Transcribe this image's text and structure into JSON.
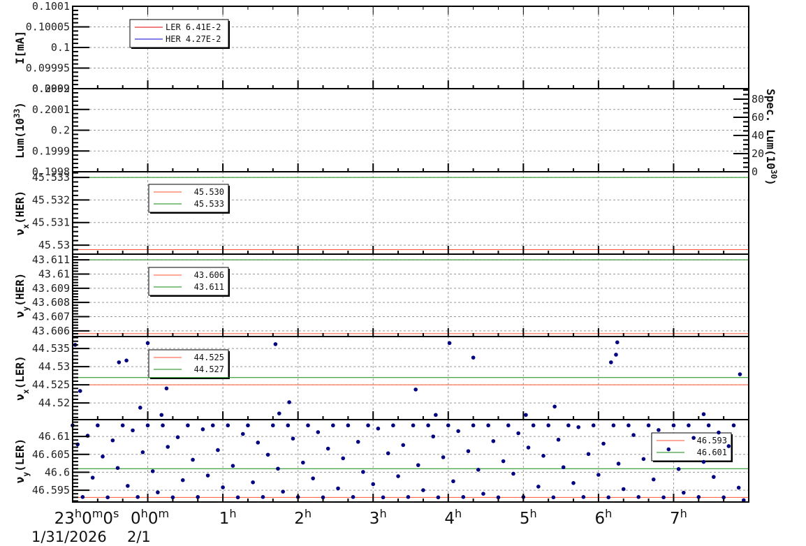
{
  "chart_data": {
    "type": "scatter",
    "x_axis": {
      "xlim": [
        "23:00",
        "08:00"
      ],
      "ticks": [
        {
          "at": "23:00",
          "parts": [
            {
              "t": "23"
            },
            {
              "t": "h",
              "sup": true
            },
            {
              "t": "0"
            },
            {
              "t": "m",
              "sup": true
            },
            {
              "t": "0"
            },
            {
              "t": "s",
              "sup": true
            }
          ]
        },
        {
          "at": "00:00",
          "parts": [
            {
              "t": "0"
            },
            {
              "t": "h",
              "sup": true
            },
            {
              "t": "0"
            },
            {
              "t": "m",
              "sup": true
            }
          ]
        },
        {
          "at": "01:00",
          "parts": [
            {
              "t": "1"
            },
            {
              "t": "h",
              "sup": true
            }
          ]
        },
        {
          "at": "02:00",
          "parts": [
            {
              "t": "2"
            },
            {
              "t": "h",
              "sup": true
            }
          ]
        },
        {
          "at": "03:00",
          "parts": [
            {
              "t": "3"
            },
            {
              "t": "h",
              "sup": true
            }
          ]
        },
        {
          "at": "04:00",
          "parts": [
            {
              "t": "4"
            },
            {
              "t": "h",
              "sup": true
            }
          ]
        },
        {
          "at": "05:00",
          "parts": [
            {
              "t": "5"
            },
            {
              "t": "h",
              "sup": true
            }
          ]
        },
        {
          "at": "06:00",
          "parts": [
            {
              "t": "6"
            },
            {
              "t": "h",
              "sup": true
            }
          ]
        },
        {
          "at": "07:00",
          "parts": [
            {
              "t": "7"
            },
            {
              "t": "h",
              "sup": true
            }
          ]
        }
      ],
      "dates": [
        "1/31/2026",
        "2/1"
      ],
      "grid": true
    },
    "colors": {
      "red": "#ff5533",
      "green": "#118811",
      "ler": "#dd0000",
      "her": "#0000cc",
      "points": "#000080"
    },
    "panels": [
      {
        "id": "current",
        "ylabel": [
          {
            "t": "I[mA]"
          }
        ],
        "ylim": [
          0.0999,
          0.1001
        ],
        "yticks": [
          {
            "v": 0.1001,
            "label": "0.1001"
          },
          {
            "v": 0.10005,
            "label": "0.10005"
          },
          {
            "v": 0.1,
            "label": "0.1"
          },
          {
            "v": 0.09995,
            "label": "0.09995"
          },
          {
            "v": 0.0999,
            "label": "0.0999"
          }
        ],
        "legend": [
          {
            "label": "LER  6.41E-2",
            "color": "#dd0000"
          },
          {
            "label": "HER  4.27E-2",
            "color": "#0000cc"
          }
        ],
        "lines": [],
        "points": []
      },
      {
        "id": "luminosity",
        "ylabel": [
          {
            "t": "Lum(10"
          },
          {
            "t": "33",
            "sup": true
          },
          {
            "t": ")"
          }
        ],
        "ylim": [
          0.1998,
          0.2002
        ],
        "yticks": [
          {
            "v": 0.2002,
            "label": "0.2002"
          },
          {
            "v": 0.2001,
            "label": "0.2001"
          },
          {
            "v": 0.2,
            "label": "0.2"
          },
          {
            "v": 0.1999,
            "label": "0.1999"
          },
          {
            "v": 0.1998,
            "label": "0.1998"
          }
        ],
        "right_axis": {
          "ylabel": [
            {
              "t": "Spec. Lum(10"
            },
            {
              "t": "30",
              "sup": true
            },
            {
              "t": ")"
            }
          ],
          "ylim": [
            0,
            91.5
          ],
          "yticks": [
            {
              "v": 0,
              "label": "0"
            },
            {
              "v": 20,
              "label": "20"
            },
            {
              "v": 40,
              "label": "40"
            },
            {
              "v": 60,
              "label": "60"
            },
            {
              "v": 80,
              "label": "80"
            }
          ]
        },
        "legend": [],
        "lines": [],
        "points": []
      },
      {
        "id": "nux-her",
        "ylabel": [
          {
            "t": "ν"
          },
          {
            "t": "x",
            "sub": true
          },
          {
            "t": "(HER)"
          }
        ],
        "ylim": [
          45.5296,
          45.53325
        ],
        "yticks": [
          {
            "v": 45.533,
            "label": "45.533"
          },
          {
            "v": 45.532,
            "label": "45.532"
          },
          {
            "v": 45.531,
            "label": "45.531"
          },
          {
            "v": 45.53,
            "label": "45.53"
          }
        ],
        "legend": [
          {
            "label": "45.530",
            "color": "#ff5533"
          },
          {
            "label": "45.533",
            "color": "#118811"
          }
        ],
        "lines": [
          {
            "v": 45.5298,
            "color": "#ff5533"
          },
          {
            "v": 45.533,
            "color": "#118811"
          }
        ],
        "points": []
      },
      {
        "id": "nuy-her",
        "ylabel": [
          {
            "t": "ν"
          },
          {
            "t": "y",
            "sub": true
          },
          {
            "t": "(HER)"
          }
        ],
        "ylim": [
          43.6056,
          43.6114
        ],
        "yticks": [
          {
            "v": 43.611,
            "label": "43.611"
          },
          {
            "v": 43.61,
            "label": "43.61"
          },
          {
            "v": 43.609,
            "label": "43.609"
          },
          {
            "v": 43.608,
            "label": "43.608"
          },
          {
            "v": 43.607,
            "label": "43.607"
          },
          {
            "v": 43.606,
            "label": "43.606"
          }
        ],
        "legend": [
          {
            "label": "43.606",
            "color": "#ff5533"
          },
          {
            "label": "43.611",
            "color": "#118811"
          }
        ],
        "lines": [
          {
            "v": 43.6058,
            "color": "#ff5533"
          },
          {
            "v": 43.611,
            "color": "#118811"
          }
        ],
        "points": []
      },
      {
        "id": "nux-ler",
        "ylabel": [
          {
            "t": "ν"
          },
          {
            "t": "x",
            "sub": true
          },
          {
            "t": "(LER)"
          }
        ],
        "ylim": [
          44.5154,
          44.5383
        ],
        "yticks": [
          {
            "v": 44.535,
            "label": "44.535"
          },
          {
            "v": 44.53,
            "label": "44.53"
          },
          {
            "v": 44.525,
            "label": "44.525"
          },
          {
            "v": 44.52,
            "label": "44.52"
          }
        ],
        "legend": [
          {
            "label": "44.525",
            "color": "#ff5533"
          },
          {
            "label": "44.527",
            "color": "#118811"
          }
        ],
        "lines": [
          {
            "v": 44.525,
            "color": "#ff5533"
          },
          {
            "v": 44.527,
            "color": "#118811"
          }
        ],
        "points": [
          [
            "23:02",
            44.536
          ],
          [
            "23:06",
            44.5233
          ],
          [
            "23:37",
            44.5312
          ],
          [
            "23:43",
            44.5317
          ],
          [
            "23:54",
            44.5187
          ],
          [
            "00:00",
            44.5365
          ],
          [
            "00:11",
            44.5167
          ],
          [
            "00:15",
            44.524
          ],
          [
            "01:42",
            44.5362
          ],
          [
            "01:45",
            44.5171
          ],
          [
            "01:53",
            44.5202
          ],
          [
            "03:34",
            44.5237
          ],
          [
            "03:50",
            44.5167
          ],
          [
            "04:01",
            44.5365
          ],
          [
            "04:20",
            44.5325
          ],
          [
            "05:02",
            44.5167
          ],
          [
            "05:25",
            44.519
          ],
          [
            "06:10",
            44.5312
          ],
          [
            "06:14",
            44.5333
          ],
          [
            "06:15",
            44.5367
          ],
          [
            "07:24",
            44.5169
          ],
          [
            "07:53",
            44.5279
          ]
        ]
      },
      {
        "id": "nuy-ler",
        "ylabel": [
          {
            "t": "ν"
          },
          {
            "t": "y",
            "sub": true
          },
          {
            "t": "(LER)"
          }
        ],
        "ylim": [
          46.5917,
          46.6147
        ],
        "yticks": [
          {
            "v": 46.61,
            "label": "46.61"
          },
          {
            "v": 46.605,
            "label": "46.605"
          },
          {
            "v": 46.6,
            "label": "46.6"
          },
          {
            "v": 46.595,
            "label": "46.595"
          }
        ],
        "legend": [
          {
            "label": "46.593",
            "color": "#ff5533"
          },
          {
            "label": "46.601",
            "color": "#118811"
          }
        ],
        "lines": [
          {
            "v": 46.593,
            "color": "#ff5533"
          },
          {
            "v": 46.601,
            "color": "#118811"
          }
        ],
        "points": [
          [
            "23:00",
            46.6131
          ],
          [
            "23:04",
            46.6078
          ],
          [
            "23:08",
            46.5931
          ],
          [
            "23:12",
            46.6102
          ],
          [
            "23:16",
            46.5985
          ],
          [
            "23:20",
            46.6131
          ],
          [
            "23:24",
            46.6044
          ],
          [
            "23:28",
            46.593
          ],
          [
            "23:32",
            46.6089
          ],
          [
            "23:36",
            46.6012
          ],
          [
            "23:40",
            46.6131
          ],
          [
            "23:44",
            46.5962
          ],
          [
            "23:48",
            46.6117
          ],
          [
            "23:52",
            46.5931
          ],
          [
            "23:56",
            46.6056
          ],
          [
            "00:00",
            46.6131
          ],
          [
            "00:04",
            46.6003
          ],
          [
            "00:08",
            46.5944
          ],
          [
            "00:12",
            46.6131
          ],
          [
            "00:16",
            46.6071
          ],
          [
            "00:20",
            46.593
          ],
          [
            "00:24",
            46.6098
          ],
          [
            "00:28",
            46.5978
          ],
          [
            "00:32",
            46.6131
          ],
          [
            "00:36",
            46.6035
          ],
          [
            "00:40",
            46.5931
          ],
          [
            "00:44",
            46.612
          ],
          [
            "00:48",
            46.5991
          ],
          [
            "00:52",
            46.6131
          ],
          [
            "00:56",
            46.6062
          ],
          [
            "01:00",
            46.5958
          ],
          [
            "01:04",
            46.6131
          ],
          [
            "01:08",
            46.6018
          ],
          [
            "01:12",
            46.593
          ],
          [
            "01:16",
            46.6107
          ],
          [
            "01:20",
            46.6131
          ],
          [
            "01:24",
            46.5972
          ],
          [
            "01:28",
            46.6083
          ],
          [
            "01:32",
            46.5931
          ],
          [
            "01:36",
            46.6049
          ],
          [
            "01:40",
            46.6131
          ],
          [
            "01:44",
            46.601
          ],
          [
            "01:48",
            46.5946
          ],
          [
            "01:52",
            46.6131
          ],
          [
            "01:56",
            46.6094
          ],
          [
            "02:00",
            46.5931
          ],
          [
            "02:04",
            46.6027
          ],
          [
            "02:08",
            46.6131
          ],
          [
            "02:12",
            46.5983
          ],
          [
            "02:16",
            46.6112
          ],
          [
            "02:20",
            46.593
          ],
          [
            "02:24",
            46.6066
          ],
          [
            "02:28",
            46.6131
          ],
          [
            "02:32",
            46.5955
          ],
          [
            "02:36",
            46.6039
          ],
          [
            "02:40",
            46.6131
          ],
          [
            "02:44",
            46.5931
          ],
          [
            "02:48",
            46.6085
          ],
          [
            "02:52",
            46.6001
          ],
          [
            "02:56",
            46.6131
          ],
          [
            "03:00",
            46.5967
          ],
          [
            "03:04",
            46.6122
          ],
          [
            "03:08",
            46.593
          ],
          [
            "03:12",
            46.6053
          ],
          [
            "03:16",
            46.6131
          ],
          [
            "03:20",
            46.5989
          ],
          [
            "03:24",
            46.6076
          ],
          [
            "03:28",
            46.5931
          ],
          [
            "03:32",
            46.6131
          ],
          [
            "03:36",
            46.602
          ],
          [
            "03:40",
            46.595
          ],
          [
            "03:44",
            46.6131
          ],
          [
            "03:48",
            46.61
          ],
          [
            "03:52",
            46.593
          ],
          [
            "03:56",
            46.6042
          ],
          [
            "04:00",
            46.6131
          ],
          [
            "04:04",
            46.5975
          ],
          [
            "04:08",
            46.6115
          ],
          [
            "04:12",
            46.5931
          ],
          [
            "04:16",
            46.6059
          ],
          [
            "04:20",
            46.6131
          ],
          [
            "04:24",
            46.6007
          ],
          [
            "04:28",
            46.594
          ],
          [
            "04:32",
            46.6131
          ],
          [
            "04:36",
            46.6087
          ],
          [
            "04:40",
            46.593
          ],
          [
            "04:44",
            46.6031
          ],
          [
            "04:48",
            46.6131
          ],
          [
            "04:52",
            46.5996
          ],
          [
            "04:56",
            46.6109
          ],
          [
            "05:00",
            46.5931
          ],
          [
            "05:04",
            46.6069
          ],
          [
            "05:08",
            46.6131
          ],
          [
            "05:12",
            46.596
          ],
          [
            "05:16",
            46.6046
          ],
          [
            "05:20",
            46.6131
          ],
          [
            "05:24",
            46.593
          ],
          [
            "05:28",
            46.6091
          ],
          [
            "05:32",
            46.6014
          ],
          [
            "05:36",
            46.6131
          ],
          [
            "05:40",
            46.597
          ],
          [
            "05:44",
            46.6126
          ],
          [
            "05:48",
            46.5931
          ],
          [
            "05:52",
            46.6051
          ],
          [
            "05:56",
            46.6131
          ],
          [
            "06:00",
            46.5993
          ],
          [
            "06:04",
            46.608
          ],
          [
            "06:08",
            46.593
          ],
          [
            "06:12",
            46.6131
          ],
          [
            "06:16",
            46.6024
          ],
          [
            "06:20",
            46.5953
          ],
          [
            "06:24",
            46.6131
          ],
          [
            "06:28",
            46.6104
          ],
          [
            "06:32",
            46.5931
          ],
          [
            "06:36",
            46.6037
          ],
          [
            "06:40",
            46.6131
          ],
          [
            "06:44",
            46.598
          ],
          [
            "06:48",
            46.6118
          ],
          [
            "06:52",
            46.593
          ],
          [
            "06:56",
            46.6064
          ],
          [
            "07:00",
            46.6131
          ],
          [
            "07:04",
            46.6009
          ],
          [
            "07:08",
            46.5943
          ],
          [
            "07:12",
            46.6131
          ],
          [
            "07:16",
            46.6096
          ],
          [
            "07:20",
            46.5931
          ],
          [
            "07:24",
            46.6029
          ],
          [
            "07:28",
            46.6131
          ],
          [
            "07:32",
            46.5987
          ],
          [
            "07:36",
            46.6111
          ],
          [
            "07:40",
            46.593
          ],
          [
            "07:44",
            46.6073
          ],
          [
            "07:48",
            46.6131
          ],
          [
            "07:52",
            46.5957
          ],
          [
            "07:56",
            46.5922
          ]
        ]
      }
    ]
  }
}
